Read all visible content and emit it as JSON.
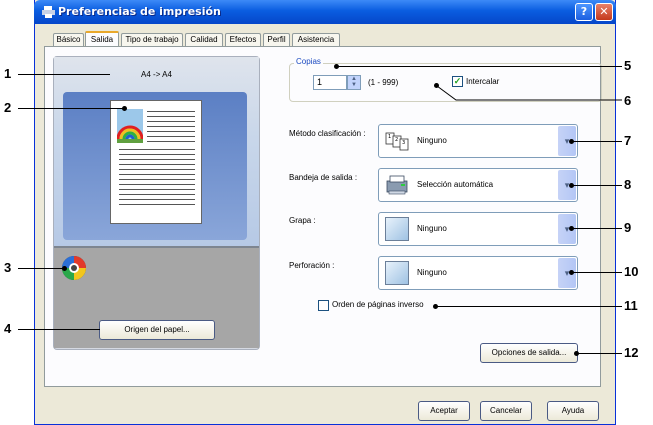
{
  "window": {
    "title": "Preferencias de impresión",
    "help": "?",
    "close": "✕"
  },
  "tabs": [
    {
      "label": "Básico"
    },
    {
      "label": "Salida",
      "active": true
    },
    {
      "label": "Tipo de trabajo"
    },
    {
      "label": "Calidad"
    },
    {
      "label": "Efectos"
    },
    {
      "label": "Perfil"
    },
    {
      "label": "Asistencia"
    }
  ],
  "preview": {
    "size_label": "A4 -> A4",
    "origin_button": "Origen del papel..."
  },
  "copies": {
    "legend": "Copias",
    "value": "1",
    "range": "(1 - 999)",
    "collate_label": "Intercalar",
    "collate_checked": true
  },
  "sort_method": {
    "label": "Método clasificación :",
    "value": "Ninguno",
    "icon": "sort-pages-icon"
  },
  "output_tray": {
    "label": "Bandeja de salida :",
    "value": "Selección automática",
    "icon": "printer-tray-icon"
  },
  "staple": {
    "label": "Grapa :",
    "value": "Ninguno"
  },
  "punch": {
    "label": "Perforación :",
    "value": "Ninguno"
  },
  "reverse_order": {
    "label": "Orden de páginas inverso",
    "checked": false
  },
  "output_options_button": "Opciones de salida...",
  "footer": {
    "accept": "Aceptar",
    "cancel": "Cancelar",
    "help": "Ayuda"
  },
  "callouts": [
    "1",
    "2",
    "3",
    "4",
    "5",
    "6",
    "7",
    "8",
    "9",
    "10",
    "11",
    "12"
  ],
  "colors": {
    "title_bar": "#0a5de0",
    "dialog_bg": "#ece9d8",
    "panel_bg": "#fcfcfe",
    "tab_highlight": "#e9a82a"
  }
}
